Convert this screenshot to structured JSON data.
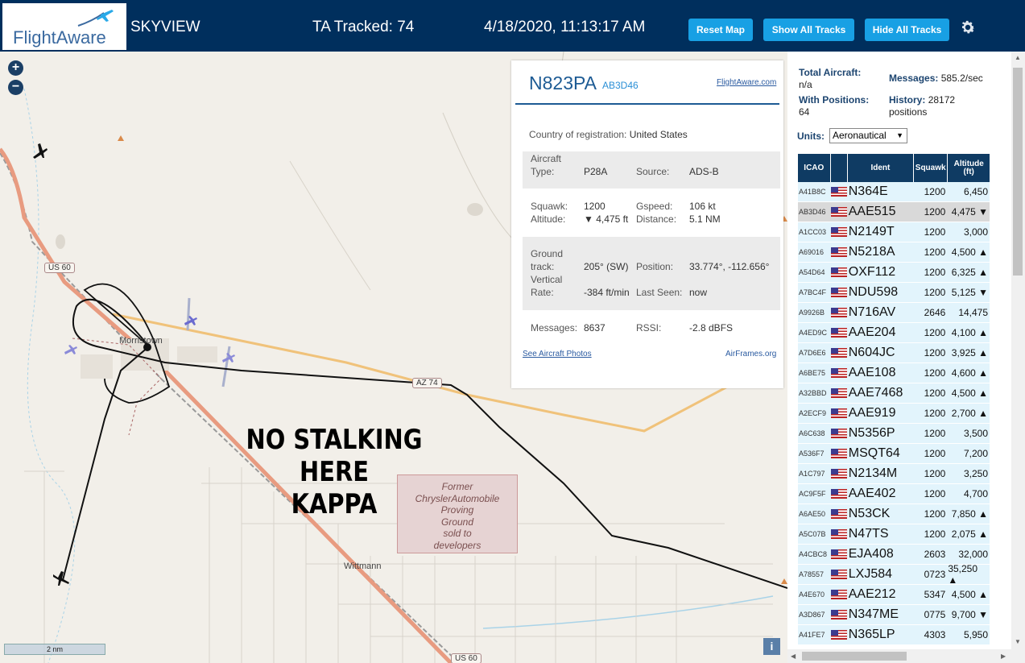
{
  "header": {
    "logo_text": "FlightAware",
    "app_name": "SKYVIEW",
    "tracked": "TA Tracked: 74",
    "datetime": "4/18/2020, 11:13:17 AM",
    "buttons": {
      "reset": "Reset Map",
      "show_all": "Show All Tracks",
      "hide_all": "Hide All Tracks"
    },
    "settings_icon": "gear-icon"
  },
  "map": {
    "zoom_in": "+",
    "zoom_out": "−",
    "overlay_text_line1": "NO STALKING HERE",
    "overlay_text_line2": "KAPPA",
    "proving_ground": [
      "Former",
      "ChryslerAutomobile",
      "Proving",
      "Ground",
      "sold to",
      "developers"
    ],
    "labels": {
      "morristown": "Morristown",
      "wittmann": "Wittmann"
    },
    "shields": {
      "us60_top": "US 60",
      "us60_bottom": "US 60",
      "az74": "AZ 74"
    },
    "scale": "2 nm",
    "info_button": "i"
  },
  "selected": {
    "ident": "N823PA",
    "icao": "AB3D46",
    "link": "FlightAware.com",
    "country_label": "Country of registration:",
    "country": "United States",
    "aircraft_type_label_1": "Aircraft",
    "aircraft_type_label_2": "Type:",
    "aircraft_type": "P28A",
    "source_label": "Source:",
    "source": "ADS-B",
    "squawk_label": "Squawk:",
    "squawk": "1200",
    "gspeed_label": "Gspeed:",
    "gspeed": "106 kt",
    "altitude_label": "Altitude:",
    "altitude": "▼ 4,475 ft",
    "distance_label": "Distance:",
    "distance": "5.1 NM",
    "ground_label_1": "Ground",
    "ground_label_2": "track:",
    "ground_track": "205° (SW)",
    "position_label": "Position:",
    "position": "33.774°, -112.656°",
    "vrate_label_1": "Vertical",
    "vrate_label_2": "Rate:",
    "vertical_rate": "-384 ft/min",
    "last_seen_label": "Last Seen:",
    "last_seen": "now",
    "messages_label": "Messages:",
    "messages": "8637",
    "rssi_label": "RSSI:",
    "rssi": "-2.8 dBFS",
    "photos_link": "See Aircraft Photos",
    "airframes_link": "AirFrames.org"
  },
  "stats": {
    "total_label": "Total Aircraft:",
    "total": "n/a",
    "messages_label": "Messages:",
    "messages": "585.2/sec",
    "with_pos_label": "With Positions:",
    "with_pos": "64",
    "history_label": "History:",
    "history": "28172",
    "history_unit": "positions",
    "units_label": "Units:",
    "units_value": "Aeronautical"
  },
  "table": {
    "headers": {
      "icao": "ICAO",
      "ident": "Ident",
      "squawk": "Squawk",
      "alt1": "Altitude",
      "alt2": "(ft)"
    },
    "rows": [
      {
        "icao": "A41B8C",
        "ident": "N364E",
        "squawk": "1200",
        "alt": "6,450"
      },
      {
        "icao": "AB3D46",
        "ident": "AAE515",
        "squawk": "1200",
        "alt": "4,475 ▼"
      },
      {
        "icao": "A1CC03",
        "ident": "N2149T",
        "squawk": "1200",
        "alt": "3,000"
      },
      {
        "icao": "A69016",
        "ident": "N5218A",
        "squawk": "1200",
        "alt": "4,500 ▲"
      },
      {
        "icao": "A54D64",
        "ident": "OXF112",
        "squawk": "1200",
        "alt": "6,325 ▲"
      },
      {
        "icao": "A7BC4F",
        "ident": "NDU598",
        "squawk": "1200",
        "alt": "5,125 ▼"
      },
      {
        "icao": "A9926B",
        "ident": "N716AV",
        "squawk": "2646",
        "alt": "14,475"
      },
      {
        "icao": "A4ED9C",
        "ident": "AAE204",
        "squawk": "1200",
        "alt": "4,100 ▲"
      },
      {
        "icao": "A7D6E6",
        "ident": "N604JC",
        "squawk": "1200",
        "alt": "3,925 ▲"
      },
      {
        "icao": "A6BE75",
        "ident": "AAE108",
        "squawk": "1200",
        "alt": "4,600 ▲"
      },
      {
        "icao": "A32BBD",
        "ident": "AAE7468",
        "squawk": "1200",
        "alt": "4,500 ▲"
      },
      {
        "icao": "A2ECF9",
        "ident": "AAE919",
        "squawk": "1200",
        "alt": "2,700 ▲"
      },
      {
        "icao": "A6C638",
        "ident": "N5356P",
        "squawk": "1200",
        "alt": "3,500"
      },
      {
        "icao": "A536F7",
        "ident": "MSQT64",
        "squawk": "1200",
        "alt": "7,200"
      },
      {
        "icao": "A1C797",
        "ident": "N2134M",
        "squawk": "1200",
        "alt": "3,250"
      },
      {
        "icao": "AC9F5F",
        "ident": "AAE402",
        "squawk": "1200",
        "alt": "4,700"
      },
      {
        "icao": "A6AE50",
        "ident": "N53CK",
        "squawk": "1200",
        "alt": "7,850 ▲"
      },
      {
        "icao": "A5C07B",
        "ident": "N47TS",
        "squawk": "1200",
        "alt": "2,075 ▲"
      },
      {
        "icao": "A4CBC8",
        "ident": "EJA408",
        "squawk": "2603",
        "alt": "32,000"
      },
      {
        "icao": "A78557",
        "ident": "LXJ584",
        "squawk": "0723",
        "alt": "35,250 ▲"
      },
      {
        "icao": "A4E670",
        "ident": "AAE212",
        "squawk": "5347",
        "alt": "4,500 ▲"
      },
      {
        "icao": "A3D867",
        "ident": "N347ME",
        "squawk": "0775",
        "alt": "9,700 ▼"
      },
      {
        "icao": "A41FE7",
        "ident": "N365LP",
        "squawk": "4303",
        "alt": "5,950"
      }
    ]
  },
  "colors": {
    "header_bg": "#002f5d",
    "button_bg": "#18a0e4",
    "table_header": "#0f3b63",
    "row_bg": "#e2f4fc",
    "selected_row": "#d9d9d9"
  }
}
